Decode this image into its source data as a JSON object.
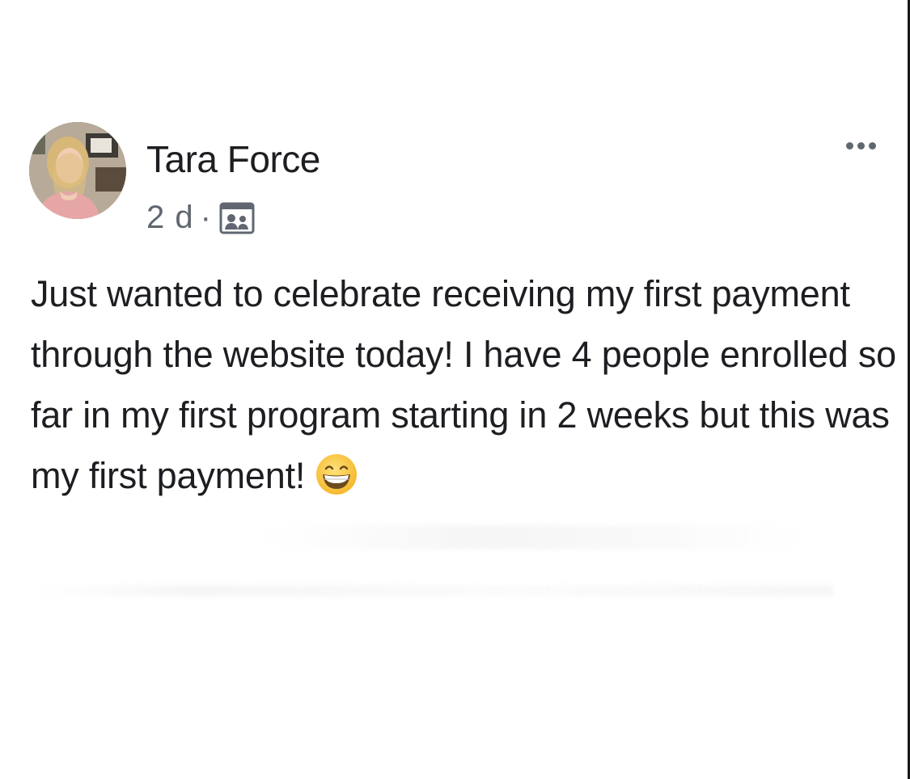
{
  "post": {
    "author": {
      "name": "Tara Force",
      "avatar_icon": "profile-photo-icon"
    },
    "timestamp": "2 d",
    "separator": "·",
    "audience_icon": "group-audience-icon",
    "more_icon": "more-options-icon",
    "text": "Just wanted to celebrate receiving my first payment through the website today! I have 4 people enrolled so far in my first program starting in 2 weeks but this was my first payment!",
    "emoji_icon": "grinning-face-emoji-icon"
  },
  "colors": {
    "text_primary": "#1c1e21",
    "text_secondary": "#606770",
    "background": "#ffffff"
  }
}
